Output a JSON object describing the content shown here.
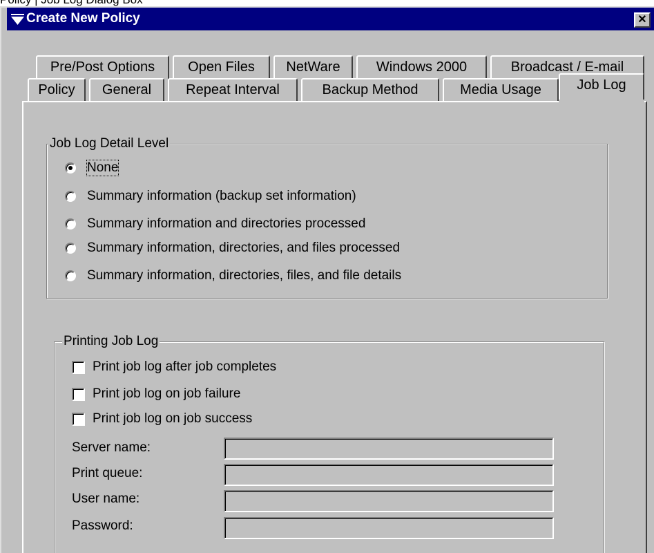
{
  "caption": "Policy | Job Log Dialog Box",
  "window": {
    "title": "Create New Policy",
    "close_label": "✕"
  },
  "tabs": {
    "row_back": [
      "Pre/Post Options",
      "Open Files",
      "NetWare",
      "Windows 2000",
      "Broadcast / E-mail"
    ],
    "row_front": [
      "Policy",
      "General",
      "Repeat Interval",
      "Backup Method",
      "Media Usage",
      "Job Log"
    ],
    "active": "Job Log"
  },
  "detail_level": {
    "legend": "Job Log Detail Level",
    "options": [
      "None",
      "Summary information (backup set information)",
      "Summary information and directories processed",
      "Summary information, directories, and files processed",
      "Summary information, directories, files, and file details"
    ],
    "selected": "None"
  },
  "printing": {
    "legend": "Printing Job Log",
    "checkboxes": [
      {
        "label": "Print job log after job completes",
        "checked": false
      },
      {
        "label": "Print job log on job failure",
        "checked": false
      },
      {
        "label": "Print job log on job success",
        "checked": false
      }
    ],
    "fields": [
      {
        "label": "Server name:",
        "value": ""
      },
      {
        "label": "Print queue:",
        "value": ""
      },
      {
        "label": "User name:",
        "value": ""
      },
      {
        "label": "Password:",
        "value": ""
      }
    ]
  },
  "icons": {
    "title": "menu-funnel-icon",
    "close": "close-icon"
  }
}
